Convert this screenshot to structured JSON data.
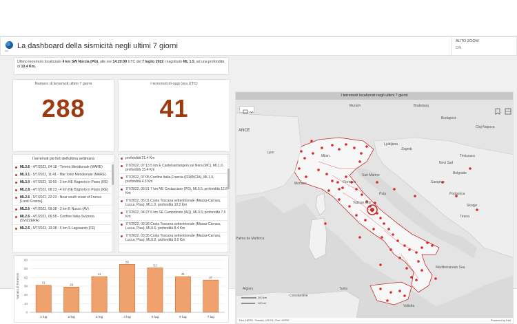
{
  "header": {
    "title": "La dashboard della sismicità negli ultimi 7 giorni",
    "logo_text": "esri",
    "autozoom_label": "AUTO ZOOM",
    "autozoom_state": "ON"
  },
  "last_quake": {
    "prefix": "Ultimo terremoto localizzato ",
    "location": "4 km SW Norcia (PG)",
    "mid1": ", alle ore ",
    "time": "14:20:09",
    "mid2": " UTC del ",
    "date": "7 luglio 2022",
    "mid3": ", magnitudo ",
    "magnitude": "ML 1.5",
    "mid4": ", ad una profondità di ",
    "depth": "10.4 Km."
  },
  "counts": {
    "week_label": "Numero di terremoti ultimi 7 giorni",
    "week_value": "288",
    "today_label": "I terremoti di oggi (ora UTC)",
    "today_value": "41"
  },
  "strong_list": {
    "title": "I terremoti più forti dell'ultima settimana",
    "items": [
      {
        "mag": "ML3.6",
        "text": " - 4/7/2022, 04:18 - Tirreno Meridionale (MARE)"
      },
      {
        "mag": "ML3.1",
        "text": " - 5/7/2022, 11:41 - Mar Ionio Meridionale (MARE)"
      },
      {
        "mag": "ML3.0",
        "text": " - 4/7/2022, 10:50 - 3 km NE Bagnolo in Piano (RE)"
      },
      {
        "mag": "ML2.8",
        "text": " - 4/7/2022, 08:23 - 4 km NE Bagnolo in Piano (RE)"
      },
      {
        "mag": "ML2.6",
        "text": " - 5/7/2022, 22:23 - Near south coast of France [Land: France]"
      },
      {
        "mag": "ML2.6",
        "text": " - 4/7/2022, 09:38 - 3 km E Nusco (AV)"
      },
      {
        "mag": "ML2.6",
        "text": " - 4/7/2022, 06:58 - Confine Italia-Svizzera (SVIZZERA)"
      },
      {
        "mag": "ML2.5",
        "text": " - 5/7/2022, 13:38 - 5 km S Lagosanto (FE)"
      }
    ]
  },
  "today_list": {
    "items": [
      {
        "text": "profondità 21.4 Km"
      },
      {
        "text": "7/7/2022, 07:13 5 km E Castelsantangelo sul Nera (MC), ML1.0, profondità 15.4 Km"
      },
      {
        "text": "7/7/2022, 07:05 Confine Italia-Francia (FRANCIA), ML1.9, profondità 4.3 Km"
      },
      {
        "text": "7/7/2022, 05:51 7 km NE Costacciaro (PG), ML0.5, profondità 12.8 Km"
      },
      {
        "text": "7/7/2022, 05:01 Costa Toscana settentrionale (Massa-Carrara, Lucca, Pisa), ML1.0, profondità 10.2 Km"
      },
      {
        "text": "7/7/2022, 04:27 6 km SE Campotosto (AQ), ML0.5, profondità 7.6 Km"
      },
      {
        "text": "7/7/2022, 03:36 Costa Toscana settentrionale (Massa-Carrara, Lucca, Pisa), ML0.6, profondità 8.4 Km"
      },
      {
        "text": "7/7/2022, 03:35 Costa Toscana settentrionale (Massa-Carrara, Lucca, Pisa), ML0.9, profondità 9.0 Km"
      }
    ]
  },
  "chart_data": {
    "type": "bar",
    "categories": [
      "1 lug",
      "2 lug",
      "3 lug",
      "4 lug",
      "5 lug",
      "6 lug",
      "7 lug"
    ],
    "values": [
      31,
      29,
      41,
      55,
      51,
      41,
      37
    ],
    "ylabel": "Numero di Terremoti",
    "ylim": [
      0,
      60
    ],
    "yticks": [
      0,
      10,
      20,
      30,
      40,
      50,
      60
    ],
    "bar_color": "#f0a26e",
    "bar_stroke": "#c96a2e",
    "grid": true
  },
  "map": {
    "title": "I terremoti localizzati negli ultimi 7 giorni",
    "labels": {
      "monaco": "Munich",
      "bratislava": "Bratislava",
      "vienna_area": "Budapest",
      "ljubljana": "Ljubljana",
      "zagreb": "Zagreb",
      "milan": "Milan",
      "lyon": "Lyon",
      "belgrade": "Belgrade",
      "sarajevo": "Sarajevo",
      "monaco_fr": "Monaco",
      "florence": "Florence",
      "sanmarino": "San Marino",
      "podgorica": "Podgorica",
      "vatican": "Vatican City",
      "skopje": "Skopje",
      "tirana": "Tirana",
      "palma": "Palma de Mallorca",
      "algiers": "Algiers",
      "constantine": "Constantine",
      "tunis": "Tunis",
      "valletta": "Valletta",
      "france": "ANCE",
      "mediterranean": "Mediterranean Sea",
      "balkan_n": "Novi Sad",
      "cluj": "Cluj-Napoca",
      "timisoara": "Timișoara",
      "pula": "Pula"
    },
    "scale_km": "200 km",
    "scale_mi": "100 mi",
    "attribution": "Esri, HERE, Garmin, USGS | Esri, HERE",
    "powered_by": "Powered by Esri"
  },
  "colors": {
    "count": "#9e3a0f",
    "quake": "#d8282a",
    "title_bar": "#c7c7c7"
  }
}
